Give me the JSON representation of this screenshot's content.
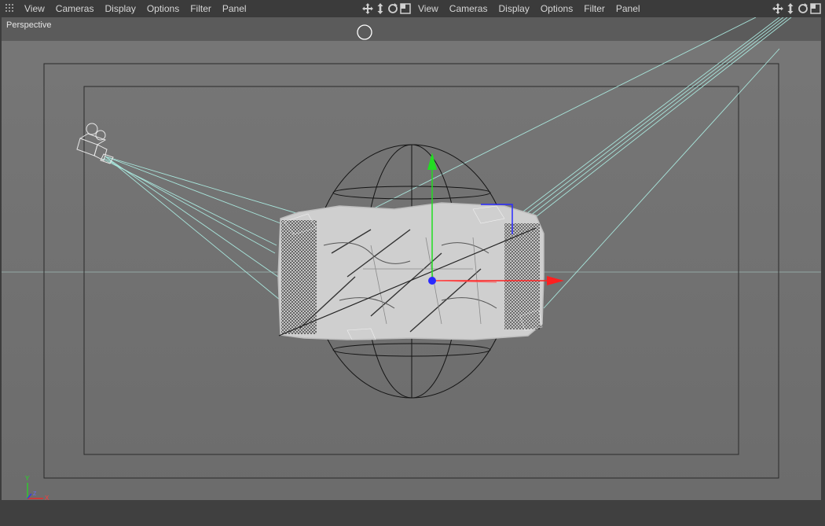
{
  "menus": {
    "left": [
      "View",
      "Cameras",
      "Display",
      "Options",
      "Filter",
      "Panel"
    ],
    "right": [
      "View",
      "Cameras",
      "Display",
      "Options",
      "Filter",
      "Panel"
    ]
  },
  "viewport": {
    "label": "Perspective"
  },
  "axis_gizmo": {
    "y": "Y",
    "z": "Z",
    "x": "X"
  },
  "icons": [
    "move-view-icon",
    "zoom-view-icon",
    "rotate-view-icon",
    "maximize-view-icon"
  ],
  "colors": {
    "x_axis": "#ff1f1f",
    "y_axis": "#22dd22",
    "z_axis": "#2a2aff",
    "camera_lines": "#a8e6dc",
    "background": "#737373"
  }
}
